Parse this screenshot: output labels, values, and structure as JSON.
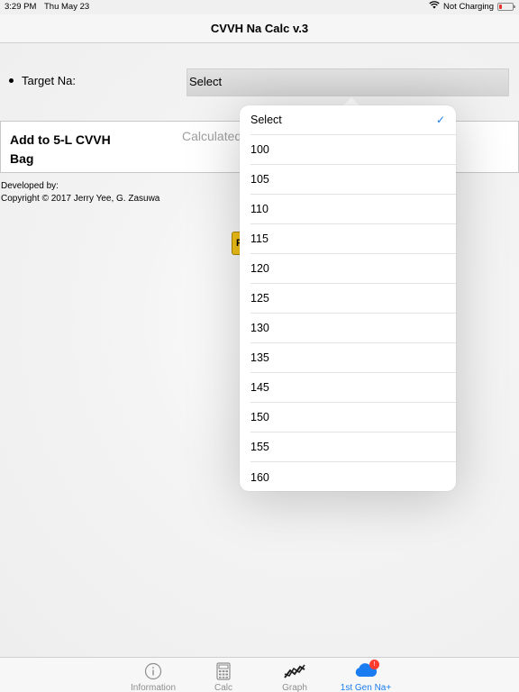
{
  "status_bar": {
    "time": "3:29 PM",
    "date": "Thu May 23",
    "charging": "Not Charging"
  },
  "nav": {
    "title": "CVVH Na Calc v.3"
  },
  "form": {
    "target_label": "Target Na:",
    "select_value": "Select"
  },
  "add_box": {
    "title": "Add to 5-L CVVH Bag",
    "calculated_label": "Calculated"
  },
  "credits": {
    "developed_by": "Developed by:",
    "copyright": "Copyright © 2017 Jerry Yee, G. Zasuwa"
  },
  "partial_button": {
    "label": "F"
  },
  "dropdown": {
    "options": [
      "Select",
      "100",
      "105",
      "110",
      "115",
      "120",
      "125",
      "130",
      "135",
      "145",
      "150",
      "155",
      "160"
    ],
    "selected": "Select"
  },
  "tabs": [
    {
      "label": "Information",
      "icon": "info-icon"
    },
    {
      "label": "Calc",
      "icon": "calculator-icon"
    },
    {
      "label": "Graph",
      "icon": "graph-icon"
    },
    {
      "label": "1st Gen Na+",
      "icon": "cloud-icon",
      "badge": "!"
    }
  ],
  "colors": {
    "accent": "#1a7cf0",
    "badge": "#ff3b30",
    "button_yellow": "#f3c316"
  }
}
